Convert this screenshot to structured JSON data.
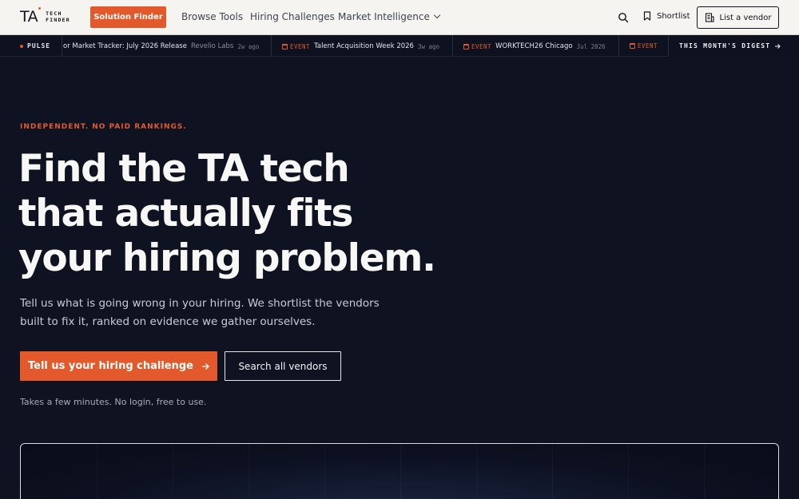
{
  "nav": {
    "logo_mark": "TA",
    "logo_sub_1": "TECH",
    "logo_sub_2": "FINDER",
    "solution_finder": "Solution Finder",
    "links": [
      "Browse Tools",
      "Hiring Challenges",
      "Market Intelligence"
    ],
    "shortlist": "Shortlist",
    "list_vendor": "List a vendor"
  },
  "ticker": {
    "label": "PULSE",
    "items": [
      {
        "tag": "",
        "title": "or Market Tracker: July 2026 Release",
        "source": "Revelio Labs",
        "age": "2w ago"
      },
      {
        "tag": "EVENT",
        "title": "Talent Acquisition Week 2026",
        "source": "",
        "age": "3w ago"
      },
      {
        "tag": "EVENT",
        "title": "WORKTECH26 Chicago",
        "source": "",
        "age": "Jul 2026"
      },
      {
        "tag": "EVENT",
        "title": "",
        "source": "",
        "age": ""
      }
    ],
    "digest": "THIS MONTH'S DIGEST"
  },
  "hero": {
    "eyebrow": "INDEPENDENT. NO PAID RANKINGS.",
    "headline_1": "Find the TA tech",
    "headline_2": "that actually fits",
    "headline_3": "your hiring problem.",
    "sub_1": "Tell us what is going wrong in your hiring. We shortlist the vendors",
    "sub_2": "built to fix it, ranked on evidence we gather ourselves.",
    "cta_primary": "Tell us your hiring challenge",
    "cta_secondary": "Search all vendors",
    "note": "Takes a few minutes. No login, free to use."
  },
  "colors": {
    "accent": "#e25a2c",
    "background": "#0f1321",
    "nav_bg": "#f6f4f1"
  },
  "icons": [
    "search-icon",
    "bookmark-icon",
    "building-icon",
    "calendar-icon",
    "arrow-right-icon",
    "chevron-down-icon"
  ]
}
